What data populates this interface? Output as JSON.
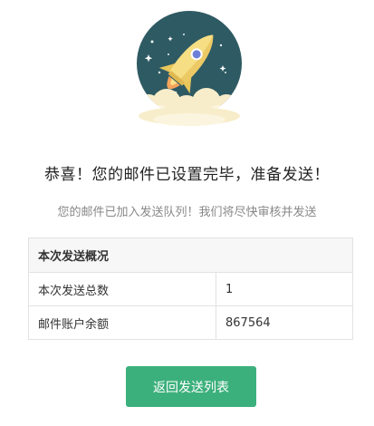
{
  "hero": {
    "icon": "rocket-icon",
    "colors": {
      "circle": "#2e5a63",
      "rocket_body": "#f5de83",
      "rocket_accent": "#6b7fd8",
      "cloud": "#f8edca"
    }
  },
  "message": {
    "title": "恭喜！您的邮件已设置完毕，准备发送！",
    "subtitle": "您的邮件已加入发送队列！我们将尽快审核并发送"
  },
  "summary": {
    "header": "本次发送概况",
    "rows": [
      {
        "label": "本次发送总数",
        "value": "1"
      },
      {
        "label": "邮件账户余额",
        "value": "867564"
      }
    ]
  },
  "actions": {
    "back_label": "返回发送列表",
    "button_color": "#3cb07c"
  }
}
